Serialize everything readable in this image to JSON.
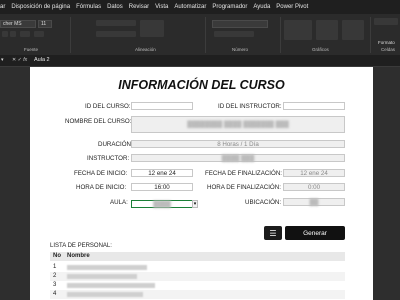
{
  "menu": [
    "ar",
    "Disposición de página",
    "Fórmulas",
    "Datos",
    "Revisar",
    "Vista",
    "Automatizar",
    "Programador",
    "Ayuda",
    "Power Pivot"
  ],
  "ribbon": {
    "font_name": "cher MS",
    "font_size": "11",
    "group_font": "Fuente",
    "group_align": "Alineación",
    "group_number": "Número",
    "group_styles": "Gráficos",
    "group_cells": "Celdas",
    "format_label": "Formato"
  },
  "formula_bar": {
    "fx": "fx",
    "cell_content": "Aula 2"
  },
  "sheet": {
    "title": "INFORMACIÓN DEL CURSO",
    "labels": {
      "course_id": "ID DEL CURSO:",
      "instructor_id": "ID DEL INSTRUCTOR:",
      "course_name": "NOMBRE DEL CURSO:",
      "duration": "DURACIÓN:",
      "instructor": "INSTRUCTOR:",
      "start_date": "FECHA DE INICIO:",
      "end_date": "FECHA DE FINALIZACIÓN:",
      "start_time": "HORA DE INICIO:",
      "end_time": "HORA DE FINALIZACIÓN:",
      "classroom": "AULA:",
      "location": "UBICACIÓN:"
    },
    "values": {
      "course_id": "",
      "instructor_id": "",
      "duration": "8 Horas / 1 Día",
      "start_date": "12 ene 24",
      "end_date": "12 ene 24",
      "start_time": "16:00",
      "end_time": "0:00"
    },
    "generate_label": "Generar",
    "staff_title": "LISTA DE PERSONAL:",
    "staff_headers": {
      "no": "No",
      "name": "Nombre"
    },
    "staff_rows": [
      "1",
      "2",
      "3",
      "4"
    ]
  }
}
